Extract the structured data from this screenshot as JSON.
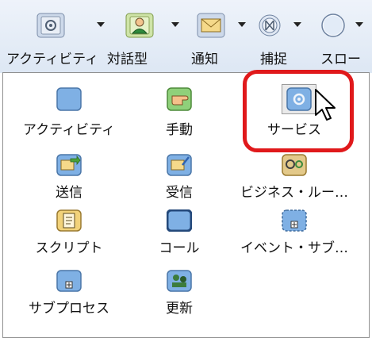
{
  "toolbar": {
    "items": [
      {
        "label": "アクティビティ",
        "icon": "activity-gear-icon"
      },
      {
        "label": "対話型",
        "icon": "user-icon"
      },
      {
        "label": "通知",
        "icon": "envelope-icon"
      },
      {
        "label": "捕捉",
        "icon": "catch-icon"
      },
      {
        "label": "スロー",
        "icon": "throw-icon"
      }
    ]
  },
  "palette": {
    "items": [
      {
        "label": "アクティビティ",
        "icon": "activity-icon"
      },
      {
        "label": "手動",
        "icon": "hand-icon"
      },
      {
        "label": "サービス",
        "icon": "service-gear-icon"
      },
      {
        "label": "送信",
        "icon": "send-icon"
      },
      {
        "label": "受信",
        "icon": "receive-icon"
      },
      {
        "label": "ビジネス・ルー…",
        "icon": "business-rule-icon"
      },
      {
        "label": "スクリプト",
        "icon": "script-icon"
      },
      {
        "label": "コール",
        "icon": "call-icon"
      },
      {
        "label": "イベント・サブ…",
        "icon": "event-subprocess-icon"
      },
      {
        "label": "サブプロセス",
        "icon": "subprocess-icon"
      },
      {
        "label": "更新",
        "icon": "update-icon"
      }
    ]
  },
  "colors": {
    "highlight": "#e0191b",
    "activity_blue": "#7fb0e4"
  }
}
